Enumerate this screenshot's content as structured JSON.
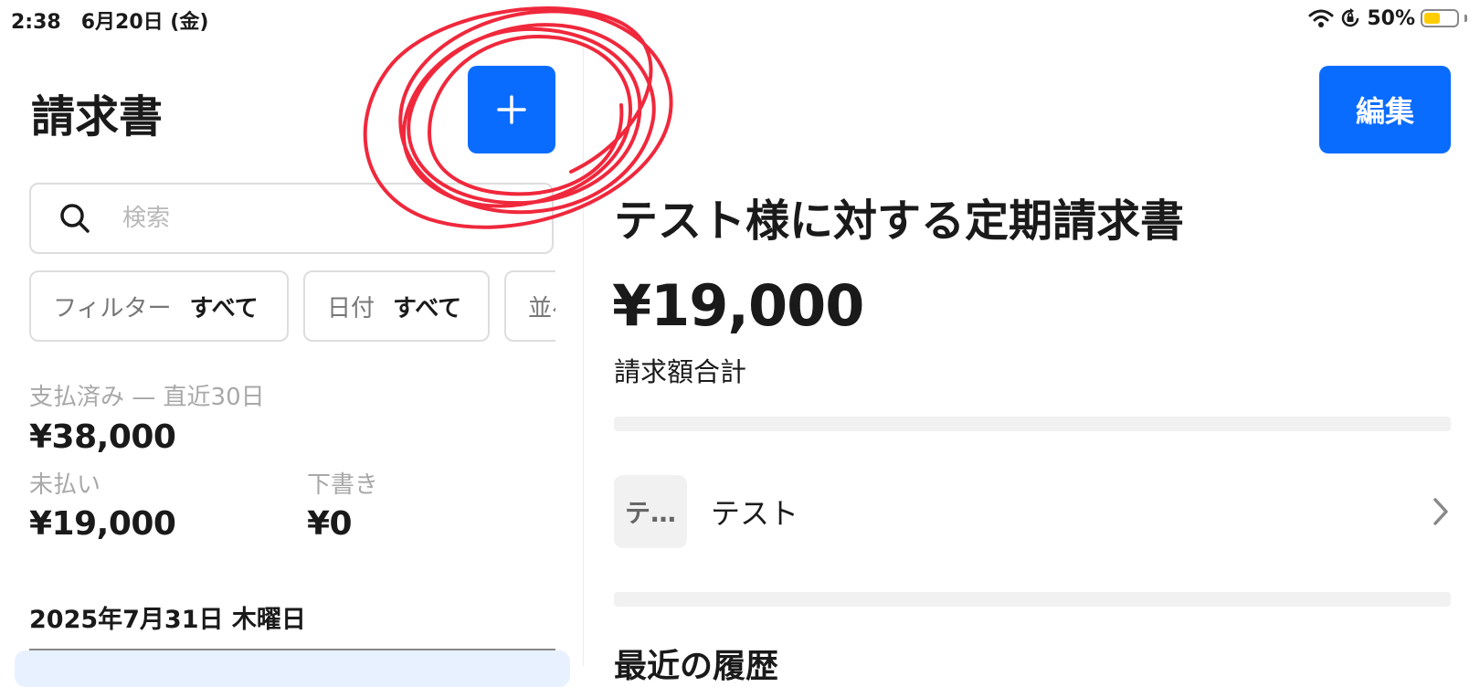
{
  "status_bar": {
    "time_date": "2:38　6月20日 (金)",
    "battery": "50%",
    "battery_level": 0.5,
    "icons": [
      "wifi-icon",
      "orientation-lock-icon",
      "battery-icon"
    ]
  },
  "left_pane": {
    "title": "請求書",
    "add_button_label": "+",
    "search": {
      "placeholder": "検索",
      "value": ""
    },
    "chips": [
      {
        "label": "フィルター",
        "value": "すべて"
      },
      {
        "label": "日付",
        "value": "すべて"
      },
      {
        "label": "並べ替え",
        "value": ""
      }
    ],
    "stats": {
      "paid_label": "支払済み — 直近30日",
      "paid_value": "¥38,000",
      "unpaid_label": "未払い",
      "unpaid_value": "¥19,000",
      "draft_label": "下書き",
      "draft_value": "¥0"
    },
    "date_header": "2025年7月31日 木曜日"
  },
  "right_pane": {
    "edit_button_label": "編集",
    "invoice_title": "テスト様に対する定期請求書",
    "amount": "¥19,000",
    "amount_label": "請求額合計",
    "customer": {
      "avatar_text": "テ…",
      "name": "テスト"
    },
    "recent_heading": "最近の履歴"
  },
  "colors": {
    "accent": "#0a6cff",
    "annotation": "#f0283c",
    "battery": "#ffcc00"
  }
}
